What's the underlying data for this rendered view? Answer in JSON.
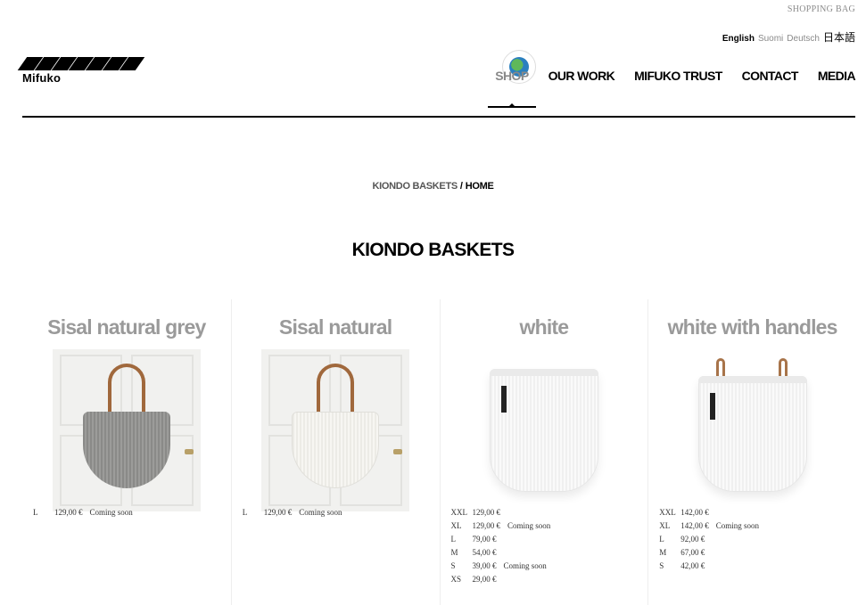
{
  "header": {
    "shopping_bag": "SHOPPING BAG",
    "languages": {
      "english": "English",
      "suomi": "Suomi",
      "deutsch": "Deutsch",
      "japanese": "日本語"
    },
    "logo_text": "Mifuko",
    "wfto_badge": "WORLD FAIR TRADE ORGANIZATION",
    "nav": [
      {
        "label": "SHOP",
        "active": true
      },
      {
        "label": "OUR WORK",
        "active": false
      },
      {
        "label": "MIFUKO TRUST",
        "active": false
      },
      {
        "label": "CONTACT",
        "active": false
      },
      {
        "label": "MEDIA",
        "active": false
      }
    ]
  },
  "breadcrumb": {
    "current": "KIONDO BASKETS",
    "separator": "/",
    "home": "HOME"
  },
  "page_title": "KIONDO BASKETS",
  "products": [
    {
      "name": "Sisal natural grey",
      "prices": [
        {
          "size": "L",
          "price": "129,00 €",
          "note": "Coming soon"
        }
      ]
    },
    {
      "name": "Sisal natural",
      "prices": [
        {
          "size": "L",
          "price": "129,00 €",
          "note": "Coming soon"
        }
      ]
    },
    {
      "name": "white",
      "prices": [
        {
          "size": "XXL",
          "price": "129,00 €",
          "note": ""
        },
        {
          "size": "XL",
          "price": "129,00 €",
          "note": "Coming soon"
        },
        {
          "size": "L",
          "price": "79,00 €",
          "note": ""
        },
        {
          "size": "M",
          "price": "54,00 €",
          "note": ""
        },
        {
          "size": "S",
          "price": "39,00 €",
          "note": "Coming soon"
        },
        {
          "size": "XS",
          "price": "29,00 €",
          "note": ""
        }
      ]
    },
    {
      "name": "white with handles",
      "prices": [
        {
          "size": "XXL",
          "price": "142,00 €",
          "note": ""
        },
        {
          "size": "XL",
          "price": "142,00 €",
          "note": "Coming soon"
        },
        {
          "size": "L",
          "price": "92,00 €",
          "note": ""
        },
        {
          "size": "M",
          "price": "67,00 €",
          "note": ""
        },
        {
          "size": "S",
          "price": "42,00 €",
          "note": ""
        }
      ]
    }
  ],
  "colors": {
    "muted": "#9a9a9a",
    "text": "#000000",
    "leather": "#a0683c"
  }
}
